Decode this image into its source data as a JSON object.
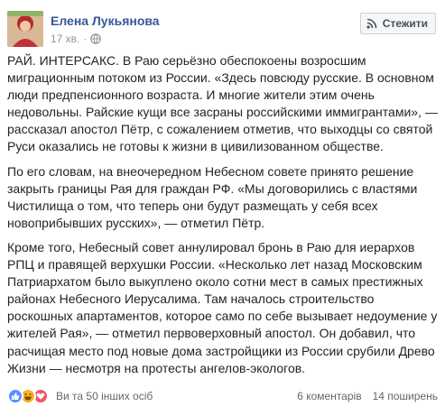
{
  "post": {
    "author": "Елена Лукьянова",
    "time": "17 хв.",
    "separator": "·",
    "follow_label": "Стежити",
    "paragraphs": [
      "РАЙ. ИНТЕРСАКС. В Раю серьёзно обеспокоены возросшим миграционным потоком из России. «Здесь повсюду русские. В основном люди предпенсионного возраста. И многие жители этим очень недовольны. Райские кущи все засраны российскими иммигрантами», — рассказал апостол Пётр, с сожалением отметив, что выходцы со святой Руси оказались не готовы к жизни в цивилизованном обществе.",
      "По его словам, на внеочередном Небесном совете принято решение закрыть границы Рая для граждан РФ. «Мы договорились с властями Чистилища о том, что теперь они будут размещать у себя всех новоприбывших русских», — отметил Пётр.",
      "Кроме того, Небесный совет аннулировал бронь в Раю для иерархов РПЦ и правящей верхушки России. «Несколько лет назад Московским Патриархатом было выкуплено около сотни мест в самых престижных районах Небесного Иерусалима. Там началось строительство роскошных апартаментов, которое само по себе вызывает недоумение у жителей Рая», — отметил первоверховный апостол. Он добавил, что расчищая место под новые дома застройщики из России срубили Древо Жизни — несмотря на протесты ангелов-экологов."
    ],
    "reactions_text": "Ви та 50 інших осіб",
    "comments": "6 коментарів",
    "shares": "14 поширень"
  },
  "colors": {
    "link": "#365899",
    "like": "#5890ff",
    "haha": "#f7b125",
    "love": "#f25268"
  },
  "icons": [
    "globe-icon",
    "rss-icon",
    "like-reaction-icon",
    "haha-reaction-icon",
    "love-reaction-icon"
  ]
}
